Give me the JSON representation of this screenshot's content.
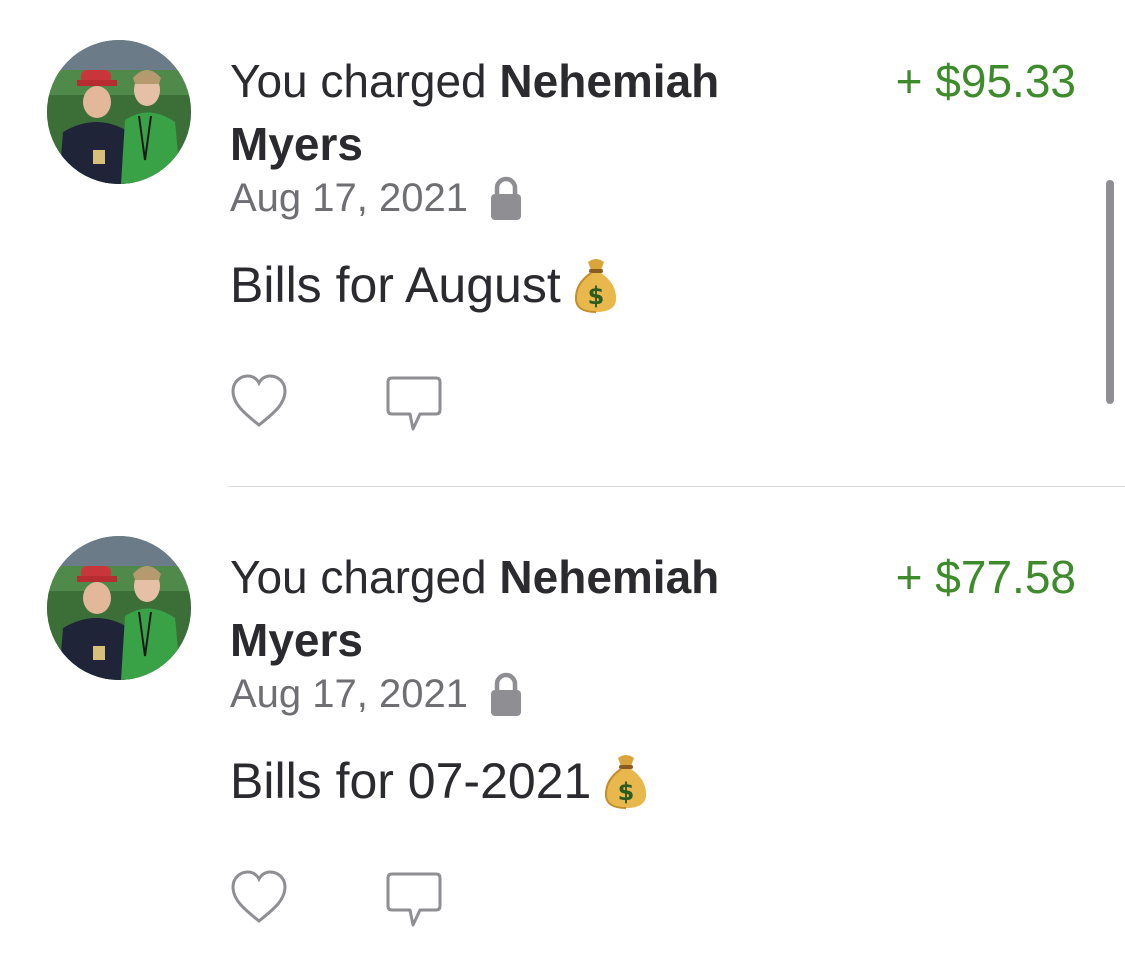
{
  "transactions": [
    {
      "prefix": "You charged ",
      "name": "Nehemiah Myers",
      "amount": "+ $95.33",
      "date": "Aug 17, 2021",
      "privacy_icon": "lock-icon",
      "note": "Bills for August",
      "note_emoji": "moneybag-icon",
      "actions": [
        "like-icon",
        "comment-icon"
      ]
    },
    {
      "prefix": "You charged ",
      "name": "Nehemiah Myers",
      "amount": "+ $77.58",
      "date": "Aug 17, 2021",
      "privacy_icon": "lock-icon",
      "note": "Bills for 07-2021",
      "note_emoji": "moneybag-icon",
      "actions": [
        "like-icon",
        "comment-icon"
      ]
    }
  ],
  "colors": {
    "amount_positive": "#3d8b2b",
    "secondary_text": "#6e6e73",
    "primary_text": "#2b2b2f",
    "icon_gray": "#8e8e93"
  }
}
